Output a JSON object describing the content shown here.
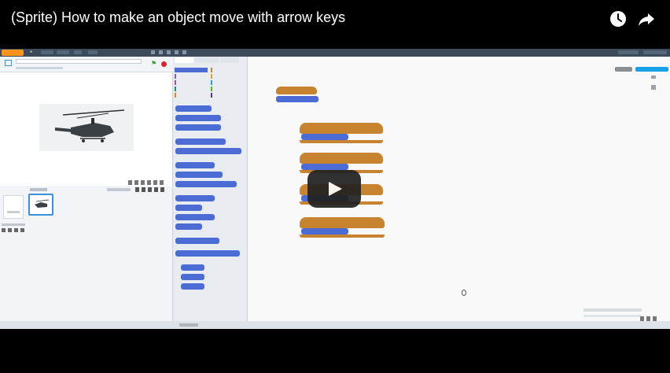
{
  "video": {
    "title": "(Sprite) How to make an object move with arrow keys"
  },
  "icons": {
    "watch_later": "clock-icon",
    "share": "share-arrow-icon",
    "play": "play-icon"
  },
  "colors": {
    "player_bg": "#000000",
    "play_button": "#212121",
    "scratch_motion_block": "#4a6cd4",
    "scratch_event_block": "#c88330",
    "scratch_menubar": "#3d4a59"
  }
}
